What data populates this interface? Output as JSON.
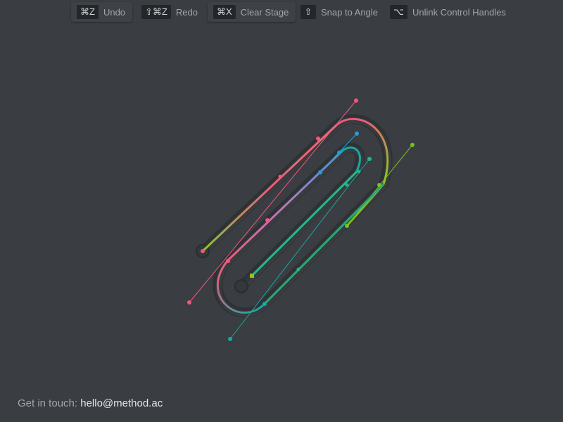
{
  "toolbar": {
    "undo": {
      "key": "⌘Z",
      "label": "Undo"
    },
    "redo": {
      "key": "⇧⌘Z",
      "label": "Redo"
    },
    "clear": {
      "key": "⌘X",
      "label": "Clear Stage"
    },
    "snap": {
      "key": "⇧",
      "label": "Snap to Angle"
    },
    "unlink": {
      "key": "⌥",
      "label": "Unlink Control Handles"
    }
  },
  "footer": {
    "prefix": "Get in touch:",
    "email": "hello@method.ac"
  },
  "colors": {
    "background": "#3a3d41",
    "pink": "#f0577f",
    "lime": "#7bbf1f",
    "blue": "#2a9bd9",
    "teal": "#1aa7a0",
    "green": "#26b48b"
  },
  "icons": {
    "artwork": "paperclip-bezier-icon"
  }
}
